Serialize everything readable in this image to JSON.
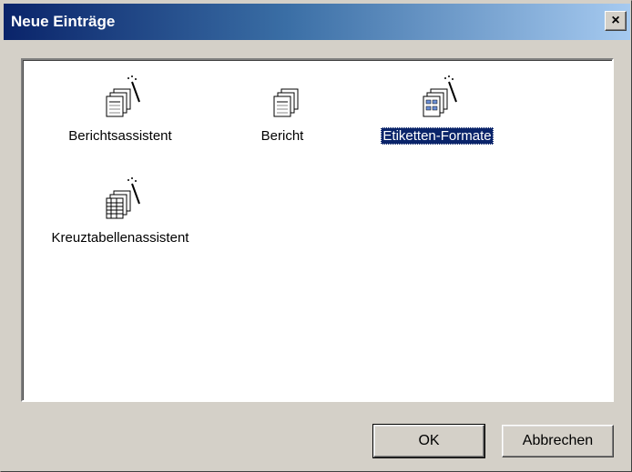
{
  "window": {
    "title": "Neue Einträge",
    "close_glyph": "×"
  },
  "items": [
    {
      "label": "Berichtsassistent",
      "icon": "report-wizard-icon",
      "selected": false
    },
    {
      "label": "Bericht",
      "icon": "report-icon",
      "selected": false
    },
    {
      "label": "Etiketten-Formate",
      "icon": "label-wizard-icon",
      "selected": true
    },
    {
      "label": "Kreuztabellenassistent",
      "icon": "crosstab-wizard-icon",
      "selected": false
    }
  ],
  "buttons": {
    "ok": "OK",
    "cancel": "Abbrechen"
  },
  "colors": {
    "titlebar_start": "#0a246a",
    "titlebar_end": "#a6caf0",
    "selection": "#0a246a",
    "face": "#d4d0c8"
  }
}
